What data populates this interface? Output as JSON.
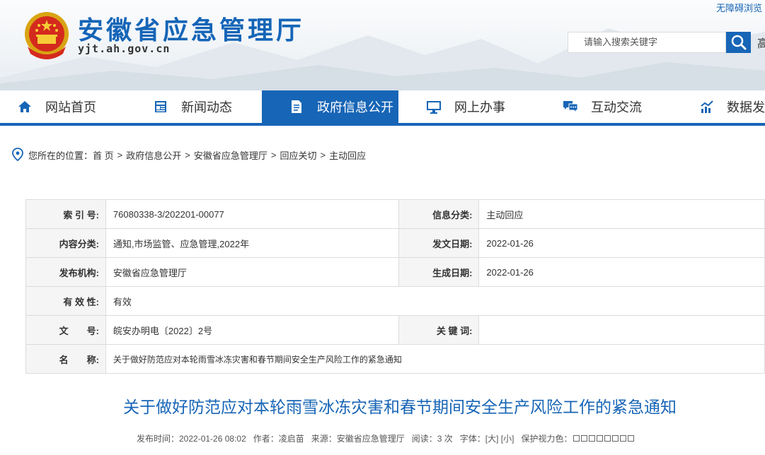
{
  "header": {
    "accessibility_link": "无障碍浏览",
    "site_title": "安徽省应急管理厅",
    "site_domain": "yjt.ah.gov.cn",
    "search_placeholder": "请输入搜索关键字",
    "overflow_text": "高"
  },
  "nav": {
    "items": [
      {
        "label": "网站首页",
        "icon": "home-icon"
      },
      {
        "label": "新闻动态",
        "icon": "news-icon"
      },
      {
        "label": "政府信息公开",
        "icon": "document-icon",
        "active": true
      },
      {
        "label": "网上办事",
        "icon": "monitor-icon"
      },
      {
        "label": "互动交流",
        "icon": "chat-icon"
      },
      {
        "label": "数据发",
        "icon": "chart-icon"
      }
    ]
  },
  "breadcrumb": {
    "prefix": "您所在的位置：",
    "items": [
      "首 页",
      "政府信息公开",
      "安徽省应急管理厅",
      "回应关切",
      "主动回应"
    ],
    "separator": ">"
  },
  "meta": {
    "index_label": "索 引 号:",
    "index_value": "76080338-3/202201-00077",
    "category_label": "信息分类:",
    "category_value": "主动回应",
    "content_label": "内容分类:",
    "content_value": "通知,市场监管、应急管理,2022年",
    "issue_date_label": "发文日期:",
    "issue_date_value": "2022-01-26",
    "publisher_label": "发布机构:",
    "publisher_value": "安徽省应急管理厅",
    "gen_date_label": "生成日期:",
    "gen_date_value": "2022-01-26",
    "validity_label": "有 效 性:",
    "validity_value": "有效",
    "docno_label": "文　　号:",
    "docno_value": "皖安办明电〔2022〕2号",
    "keywords_label": "关 键 词:",
    "keywords_value": "",
    "name_label": "名　　称:",
    "name_value": "关于做好防范应对本轮雨雪冰冻灾害和春节期间安全生产风险工作的紧急通知"
  },
  "article": {
    "title": "关于做好防范应对本轮雨雪冰冻灾害和春节期间安全生产风险工作的紧急通知",
    "publish_time": "发布时间：2022-01-26 08:02",
    "author": "作者：凌启苗",
    "source": "来源：安徽省应急管理厅",
    "views": "阅读：3 次",
    "font_size": "字体：[大] [小]",
    "eye_protect": "保护视力色："
  },
  "colors": {
    "brand_blue": "#1765b6",
    "label_bg": "#f5f5f5"
  }
}
